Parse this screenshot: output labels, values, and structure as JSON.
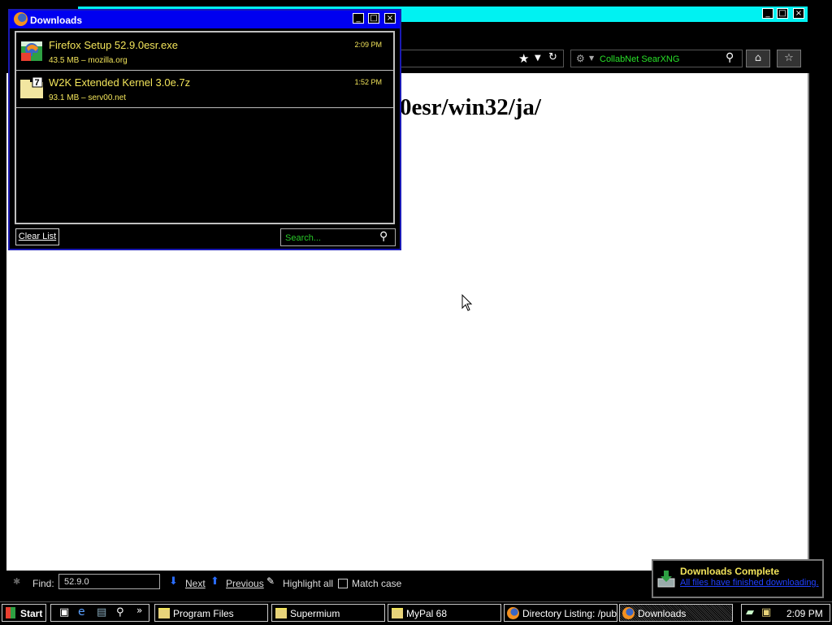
{
  "browser": {
    "window_buttons": [
      "_",
      "□",
      "×"
    ],
    "search_engine": "CollabNet SearXNG",
    "icons": [
      "star-icon",
      "dropdown-icon",
      "reload-icon",
      "search-icon",
      "home-icon",
      "bookmarks-icon"
    ]
  },
  "page": {
    "heading": "0esr/win32/ja/"
  },
  "downloads": {
    "title": "Downloads",
    "items": [
      {
        "name": "Firefox Setup 52.9.0esr.exe",
        "meta": "43.5 MB – mozilla.org",
        "time": "2:09 PM",
        "icon": "installer-icon"
      },
      {
        "name": "W2K Extended Kernel 3.0e.7z",
        "meta": "93.1 MB – serv00.net",
        "time": "1:52 PM",
        "icon": "7zip-archive-icon"
      }
    ],
    "clear_list": "Clear List",
    "search_placeholder": "Search..."
  },
  "findbar": {
    "label": "Find:",
    "value": "52.9.0",
    "next": "Next",
    "previous": "Previous",
    "highlight_all": "Highlight all",
    "match_case": "Match case"
  },
  "notification": {
    "title": "Downloads Complete",
    "link": "All files have finished downloading."
  },
  "taskbar": {
    "start": "Start",
    "buttons": [
      "Program Files",
      "Supermium",
      "MyPal 68",
      "Directory Listing: /pub...",
      "Downloads"
    ],
    "clock": "2:09 PM"
  },
  "colors": {
    "accent_text": "#f2e45a",
    "search_green": "#28e028",
    "title_blue": "#0000f0",
    "title_cyan": "#00f2f2"
  }
}
